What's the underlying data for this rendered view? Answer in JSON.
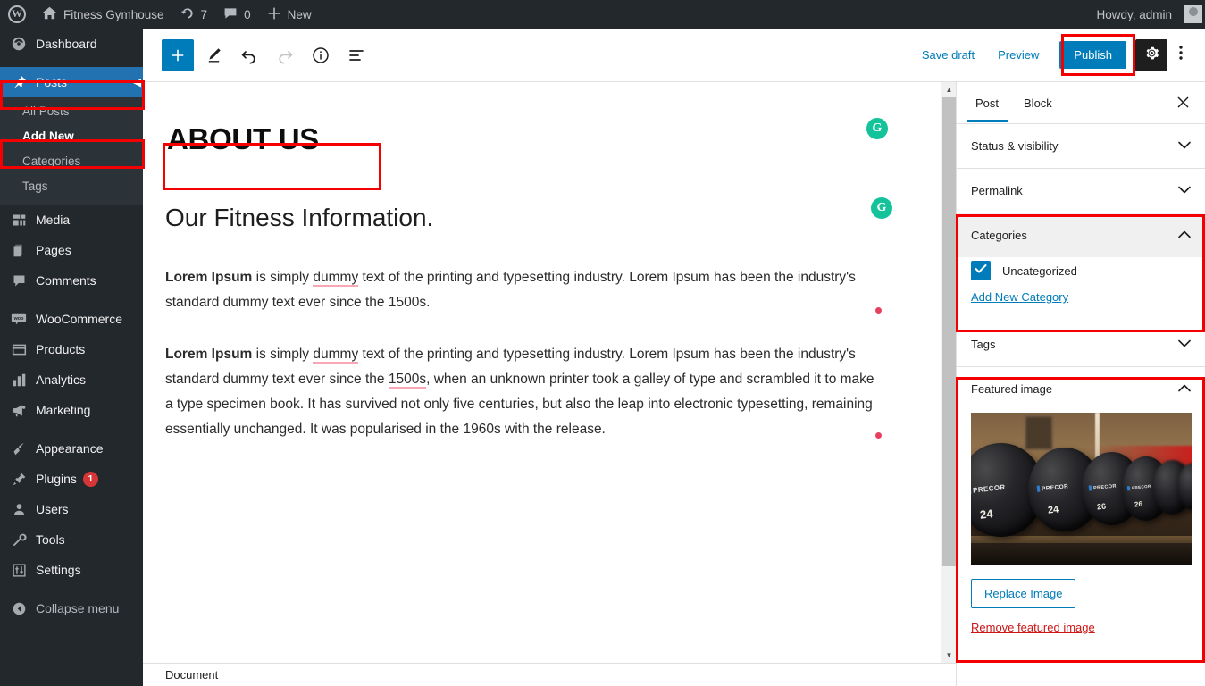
{
  "adminbar": {
    "wp_logo": "wordpress-logo",
    "site_name": "Fitness Gymhouse",
    "updates_count": "7",
    "comments_count": "0",
    "new_label": "New",
    "howdy": "Howdy, admin"
  },
  "sidebar": {
    "items": [
      {
        "label": "Dashboard",
        "icon": "dashboard-icon",
        "current": false
      },
      {
        "label": "Posts",
        "icon": "pin-icon",
        "current": true
      },
      {
        "label": "Media",
        "icon": "media-icon",
        "current": false
      },
      {
        "label": "Pages",
        "icon": "pages-icon",
        "current": false
      },
      {
        "label": "Comments",
        "icon": "comments-icon",
        "current": false
      },
      {
        "label": "WooCommerce",
        "icon": "woocommerce-icon",
        "current": false
      },
      {
        "label": "Products",
        "icon": "products-icon",
        "current": false
      },
      {
        "label": "Analytics",
        "icon": "analytics-icon",
        "current": false
      },
      {
        "label": "Marketing",
        "icon": "marketing-icon",
        "current": false
      },
      {
        "label": "Appearance",
        "icon": "appearance-icon",
        "current": false
      },
      {
        "label": "Plugins",
        "icon": "plugins-icon",
        "current": false,
        "badge": "1"
      },
      {
        "label": "Users",
        "icon": "users-icon",
        "current": false
      },
      {
        "label": "Tools",
        "icon": "tools-icon",
        "current": false
      },
      {
        "label": "Settings",
        "icon": "settings-icon",
        "current": false
      },
      {
        "label": "Collapse menu",
        "icon": "collapse-icon",
        "current": false
      }
    ],
    "submenu": [
      {
        "label": "All Posts",
        "current": false
      },
      {
        "label": "Add New",
        "current": true
      },
      {
        "label": "Categories",
        "current": false
      },
      {
        "label": "Tags",
        "current": false
      }
    ]
  },
  "editor_header": {
    "add_block_label": "+",
    "tools": [
      {
        "name": "add-block-button",
        "icon": "plus-icon"
      },
      {
        "name": "edit-tool-button",
        "icon": "pencil-icon"
      },
      {
        "name": "undo-button",
        "icon": "undo-arrow-icon"
      },
      {
        "name": "redo-button",
        "icon": "redo-arrow-icon"
      },
      {
        "name": "details-button",
        "icon": "info-circle-icon"
      },
      {
        "name": "list-view-button",
        "icon": "list-view-icon"
      }
    ],
    "save_draft": "Save draft",
    "preview": "Preview",
    "publish": "Publish",
    "settings_icon": "gear-icon",
    "more_icon": "kebab-vertical-icon"
  },
  "editor": {
    "title": "ABOUT US",
    "subheading": "Our Fitness Information.",
    "paragraph_1": {
      "bold_lead": "Lorem Ipsum",
      "part_a": " is simply ",
      "misspelled_1": "dummy",
      "part_b": " text of the printing and typesetting industry. Lorem Ipsum has been the industry's standard dummy text ever since the 1500s."
    },
    "paragraph_2": {
      "bold_lead": "Lorem Ipsum",
      "part_a": " is simply ",
      "misspelled_1": "dummy",
      "part_b": " text of the printing and typesetting industry. Lorem Ipsum has been the industry's standard dummy text ever since the ",
      "misspelled_2": "1500s",
      "part_c": ", when an unknown printer took a galley of type and scrambled it to make a type specimen book. It has survived not only five centuries, but also the leap into electronic typesetting, remaining essentially unchanged. It was popularised in the 1960s with the release."
    },
    "grammarly_badge": "G",
    "bottom_bar_label": "Document"
  },
  "inspector": {
    "tabs": [
      {
        "label": "Post",
        "active": true
      },
      {
        "label": "Block",
        "active": false
      }
    ],
    "close_icon": "close-icon",
    "panels": [
      {
        "title": "Status & visibility",
        "open": false
      },
      {
        "title": "Permalink",
        "open": false
      },
      {
        "title": "Categories",
        "open": true
      },
      {
        "title": "Tags",
        "open": false
      },
      {
        "title": "Featured image",
        "open": true
      }
    ],
    "categories": {
      "checked_item": "Uncategorized",
      "add_new_link": "Add New Category"
    },
    "featured_image": {
      "replace_button": "Replace Image",
      "remove_link": "Remove featured image",
      "alt_description": "rack of black PRECOR dumbbells",
      "weights": [
        "24",
        "24",
        "26",
        "26"
      ],
      "brand": "PRECOR"
    }
  },
  "colors": {
    "admin_dark": "#23282d",
    "submenu_dark": "#2c3338",
    "menu_current_blue": "#2271b1",
    "wp_blue": "#007cba",
    "highlight_red": "#f40000",
    "badge_red": "#d63638",
    "grammarly_green": "#15c39a",
    "spell_underline": "#f9a7b6",
    "marker_dot": "#e5405e"
  }
}
